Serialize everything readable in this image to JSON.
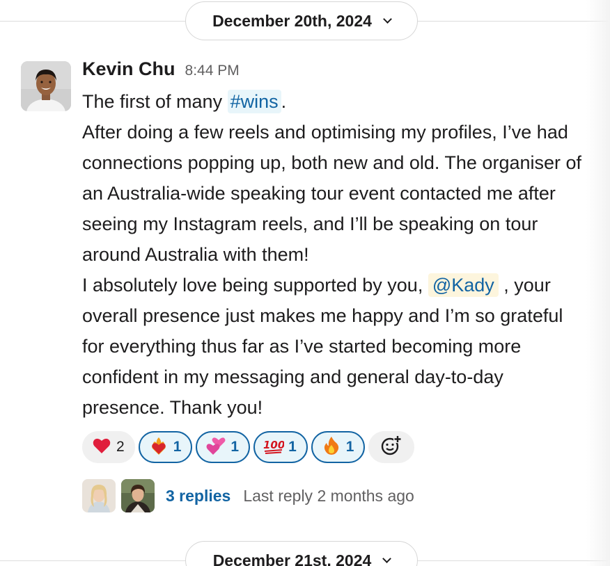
{
  "dividers": {
    "top": {
      "label": "December 20th, 2024"
    },
    "bottom": {
      "label": "December 21st, 2024"
    }
  },
  "message": {
    "author": "Kevin Chu",
    "time": "8:44 PM",
    "line1_pre": "The first of many ",
    "channel": "#wins",
    "line1_post": ".",
    "para2": "After doing a few reels and optimising my profiles, I’ve had connections popping up, both new and old. The organiser of an Australia-wide speaking tour event contacted me after seeing my Instagram reels, and I’ll be speaking on tour around Australia with them!",
    "para3_pre": "I absolutely love being supported by you, ",
    "mention": "@Kady",
    "para3_post": " , your overall presence just makes me happy and I’m so grateful for everything thus far as I’ve started becoming more confident in my messaging and general day-to-day presence. Thank you!"
  },
  "reactions": [
    {
      "emoji": "heart",
      "glyph": "❤",
      "count": "2",
      "active": false,
      "color": "#e01e3c"
    },
    {
      "emoji": "heart-on-fire",
      "glyph": "❤",
      "count": "1",
      "active": true,
      "color": "#e8501e"
    },
    {
      "emoji": "two-hearts",
      "glyph": "💕",
      "count": "1",
      "active": true,
      "color": "#e0459a"
    },
    {
      "emoji": "hundred-points",
      "glyph": "💯",
      "count": "1",
      "active": true,
      "color": "#d4151f"
    },
    {
      "emoji": "fire",
      "glyph": "🔥",
      "count": "1",
      "active": true,
      "color": "#f07a16"
    }
  ],
  "thread": {
    "replies": "3 replies",
    "last_reply": "Last reply 2 months ago"
  },
  "colors": {
    "link": "#1264a3",
    "active_reaction_bg": "#e8f5fa",
    "mention_bg": "#fdf5dd"
  }
}
